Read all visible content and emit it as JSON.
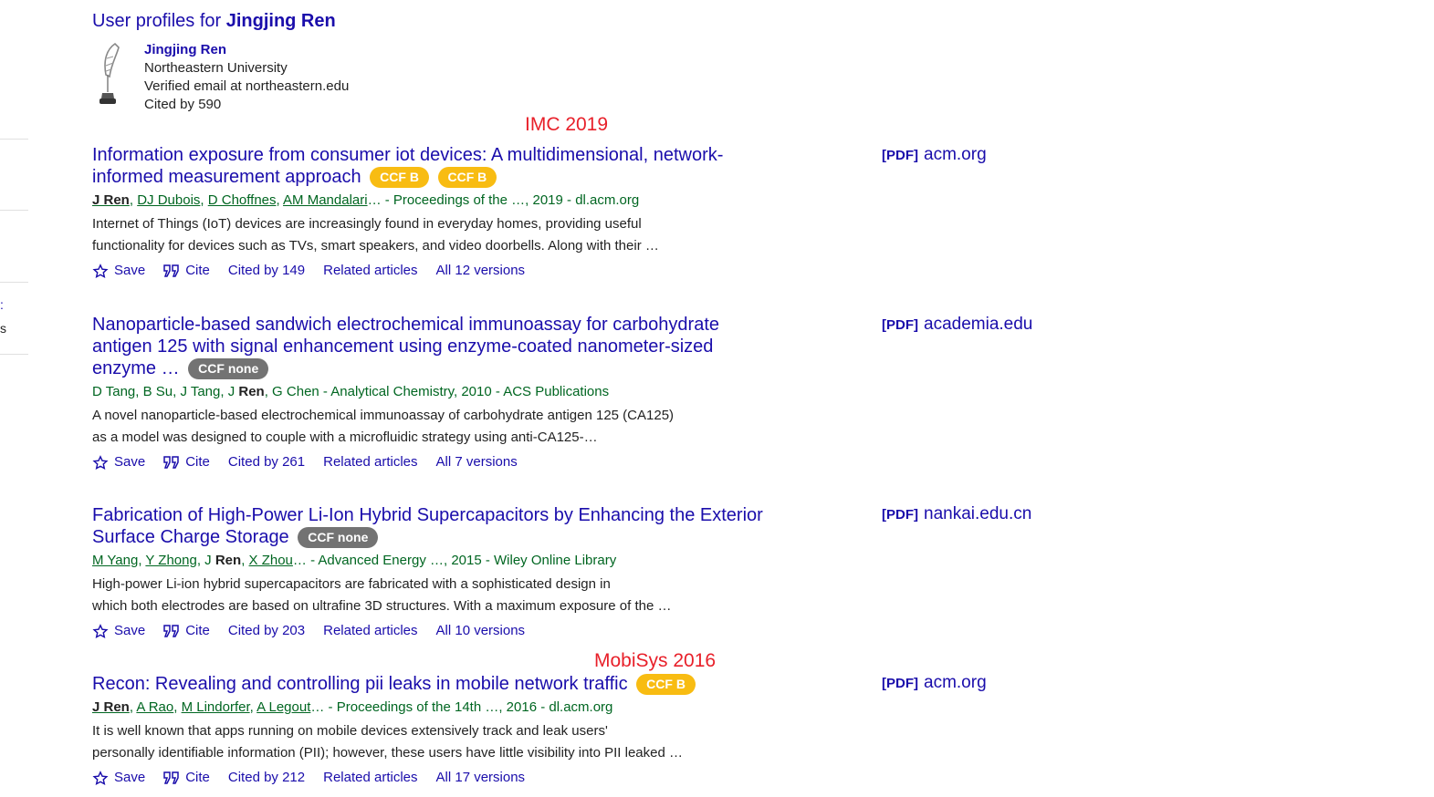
{
  "sidebar_fragments": [
    ":",
    "s"
  ],
  "profiles": {
    "prefix": "User profiles for ",
    "name_bold": "Jingjing Ren",
    "person": {
      "name": "Jingjing Ren",
      "affiliation": "Northeastern University",
      "email": "Verified email at northeastern.edu",
      "cited": "Cited by 590"
    }
  },
  "annotations": [
    "IMC 2019",
    "MobiSys 2016"
  ],
  "actions": {
    "save": "Save",
    "cite": "Cite",
    "related": "Related articles"
  },
  "colors": {
    "link": "#1a0dab",
    "green": "#006621",
    "ccf_yellow": "#f8bc12",
    "ccf_gray": "#737373",
    "annotation": "#e8202a"
  },
  "results": [
    {
      "title": "Information exposure from consumer iot devices: A multidimensional, network-informed measurement approach",
      "badges": [
        "CCF B",
        "CCF B"
      ],
      "authors": [
        {
          "t": "J Ren",
          "u": true,
          "b": true
        },
        {
          "t": ", "
        },
        {
          "t": "DJ Dubois",
          "u": true
        },
        {
          "t": ", "
        },
        {
          "t": "D Choffnes",
          "u": true
        },
        {
          "t": ", "
        },
        {
          "t": "AM Mandalari",
          "u": true
        },
        {
          "t": "… - Proceedings of the …, 2019 - dl.acm.org"
        }
      ],
      "snippet_1": "Internet of Things (IoT) devices are increasingly found in everyday homes, providing useful",
      "snippet_2": "functionality for devices such as TVs, smart speakers, and video doorbells. Along with their …",
      "cited": "Cited by 149",
      "versions": "All 12 versions",
      "pdf_tag": "[PDF]",
      "pdf_source": "acm.org"
    },
    {
      "title": "Nanoparticle-based sandwich electrochemical immunoassay for carbohydrate antigen 125 with signal enhancement using enzyme-coated nanometer-sized enzyme …",
      "badges": [
        "CCF none"
      ],
      "authors": [
        {
          "t": "D Tang, B Su, J Tang, J "
        },
        {
          "t": "Ren",
          "b": true
        },
        {
          "t": ", G Chen - Analytical Chemistry, 2010 - ACS Publications"
        }
      ],
      "snippet_1": "A novel nanoparticle-based electrochemical immunoassay of carbohydrate antigen 125 (CA125)",
      "snippet_2": "as a model was designed to couple with a microfluidic strategy using anti-CA125-…",
      "cited": "Cited by 261",
      "versions": "All 7 versions",
      "pdf_tag": "[PDF]",
      "pdf_source": "academia.edu"
    },
    {
      "title": "Fabrication of High-Power Li-Ion Hybrid Supercapacitors by Enhancing the Exterior Surface Charge Storage",
      "badges": [
        "CCF none"
      ],
      "authors": [
        {
          "t": "M Yang",
          "u": true
        },
        {
          "t": ", "
        },
        {
          "t": "Y Zhong",
          "u": true
        },
        {
          "t": ", J "
        },
        {
          "t": "Ren",
          "b": true
        },
        {
          "t": ", "
        },
        {
          "t": "X Zhou",
          "u": true
        },
        {
          "t": "… - Advanced Energy …, 2015 - Wiley Online Library"
        }
      ],
      "snippet_1": "High-power Li-ion hybrid supercapacitors are fabricated with a sophisticated design in",
      "snippet_2": "which both electrodes are based on ultrafine 3D structures. With a maximum exposure of the …",
      "cited": "Cited by 203",
      "versions": "All 10 versions",
      "pdf_tag": "[PDF]",
      "pdf_source": "nankai.edu.cn"
    },
    {
      "title": "Recon: Revealing and controlling pii leaks in mobile network traffic",
      "badges": [
        "CCF B"
      ],
      "authors": [
        {
          "t": "J Ren",
          "u": true,
          "b": true
        },
        {
          "t": ", "
        },
        {
          "t": "A Rao",
          "u": true
        },
        {
          "t": ", "
        },
        {
          "t": "M Lindorfer",
          "u": true
        },
        {
          "t": ", "
        },
        {
          "t": "A Legout",
          "u": true
        },
        {
          "t": "… - Proceedings of the 14th …, 2016 - dl.acm.org"
        }
      ],
      "snippet_1": "It is well known that apps running on mobile devices extensively track and leak users'",
      "snippet_2": "personally identifiable information (PII); however, these users have little visibility into PII leaked …",
      "cited": "Cited by 212",
      "versions": "All 17 versions",
      "pdf_tag": "[PDF]",
      "pdf_source": "acm.org"
    }
  ]
}
